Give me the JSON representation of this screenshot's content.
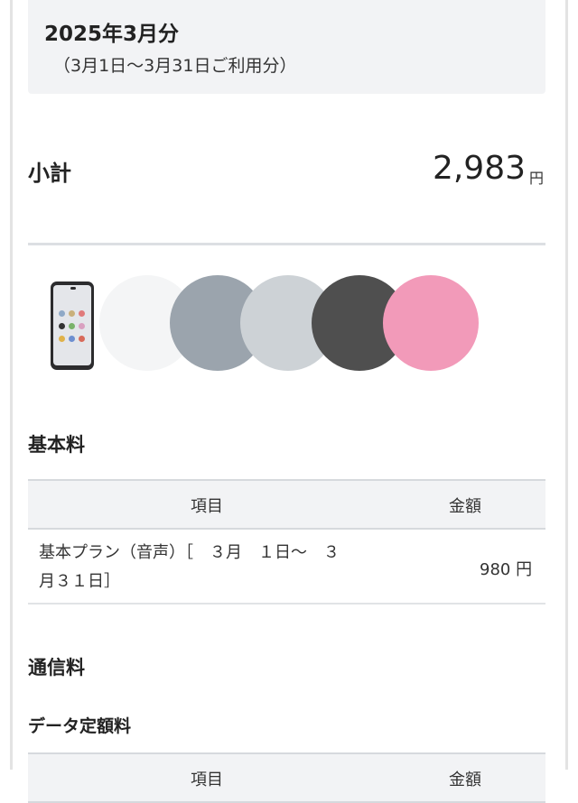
{
  "period": {
    "title": "2025年3月分",
    "range": "（3月1日〜3月31日ご利用分）"
  },
  "subtotal": {
    "label": "小計",
    "value": "2,983",
    "unit": "円"
  },
  "device": {
    "icon": "smartphone-icon",
    "color_options": [
      {
        "name": "white",
        "color": "#f4f5f6"
      },
      {
        "name": "gray-blue",
        "color": "#9ba4ad"
      },
      {
        "name": "light-gray",
        "color": "#cdd2d6"
      },
      {
        "name": "dark-gray",
        "color": "#4f4f4f"
      },
      {
        "name": "pink",
        "color": "#f29ab9"
      }
    ]
  },
  "basic_fee": {
    "title": "基本料",
    "columns": {
      "item": "項目",
      "amount": "金額"
    },
    "rows": [
      {
        "item_line1": "基本プラン（音声）［　３月　１日〜　３",
        "item_line2": "月３１日］",
        "amount": "980 円"
      }
    ]
  },
  "communication_fee": {
    "title": "通信料",
    "subtitle": "データ定額料",
    "columns": {
      "item": "項目",
      "amount": "金額"
    }
  }
}
